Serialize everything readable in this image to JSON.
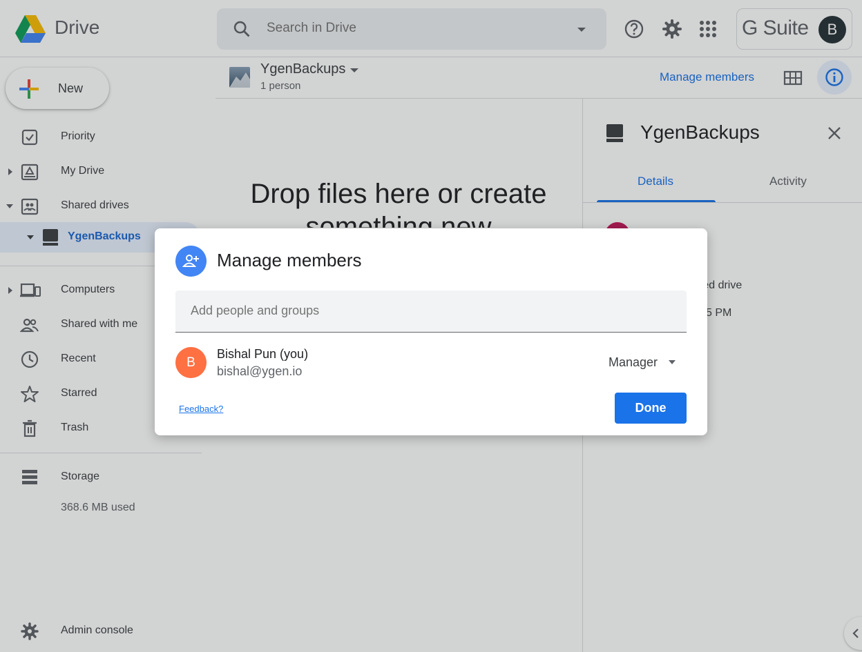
{
  "app": {
    "name": "Drive",
    "brand": "G Suite",
    "account_initial": "B"
  },
  "search": {
    "placeholder": "Search in Drive"
  },
  "sidebar": {
    "new_label": "New",
    "items": [
      {
        "label": "Priority",
        "icon": "priority-icon"
      },
      {
        "label": "My Drive",
        "icon": "my-drive-icon"
      },
      {
        "label": "Shared drives",
        "icon": "shared-drives-icon"
      },
      {
        "label": "YgenBackups",
        "icon": "drive-icon"
      },
      {
        "label": "Computers",
        "icon": "computers-icon"
      },
      {
        "label": "Shared with me",
        "icon": "people-icon"
      },
      {
        "label": "Recent",
        "icon": "clock-icon"
      },
      {
        "label": "Starred",
        "icon": "star-icon"
      },
      {
        "label": "Trash",
        "icon": "trash-icon"
      },
      {
        "label": "Storage",
        "icon": "storage-icon"
      }
    ],
    "storage_used": "368.6 MB used",
    "admin_console": "Admin console"
  },
  "header": {
    "drive_name": "YgenBackups",
    "members": "1 person",
    "manage_members": "Manage members"
  },
  "main": {
    "drop_line1": "Drop files here or create",
    "drop_line2": "something new"
  },
  "details_panel": {
    "title": "YgenBackups",
    "tabs": [
      "Details",
      "Activity"
    ],
    "type_fragment": "red drive",
    "time_fragment": "5 PM"
  },
  "dialog": {
    "title": "Manage members",
    "input_placeholder": "Add people and groups",
    "member": {
      "initial": "B",
      "name": "Bishal Pun (you)",
      "email": "bishal@ygen.io",
      "role": "Manager"
    },
    "feedback": "Feedback?",
    "done": "Done"
  },
  "colors": {
    "accent": "#1a73e8",
    "member_avatar": "#ff7043",
    "dialog_icon": "#4285f4",
    "account_avatar": "#263238"
  }
}
